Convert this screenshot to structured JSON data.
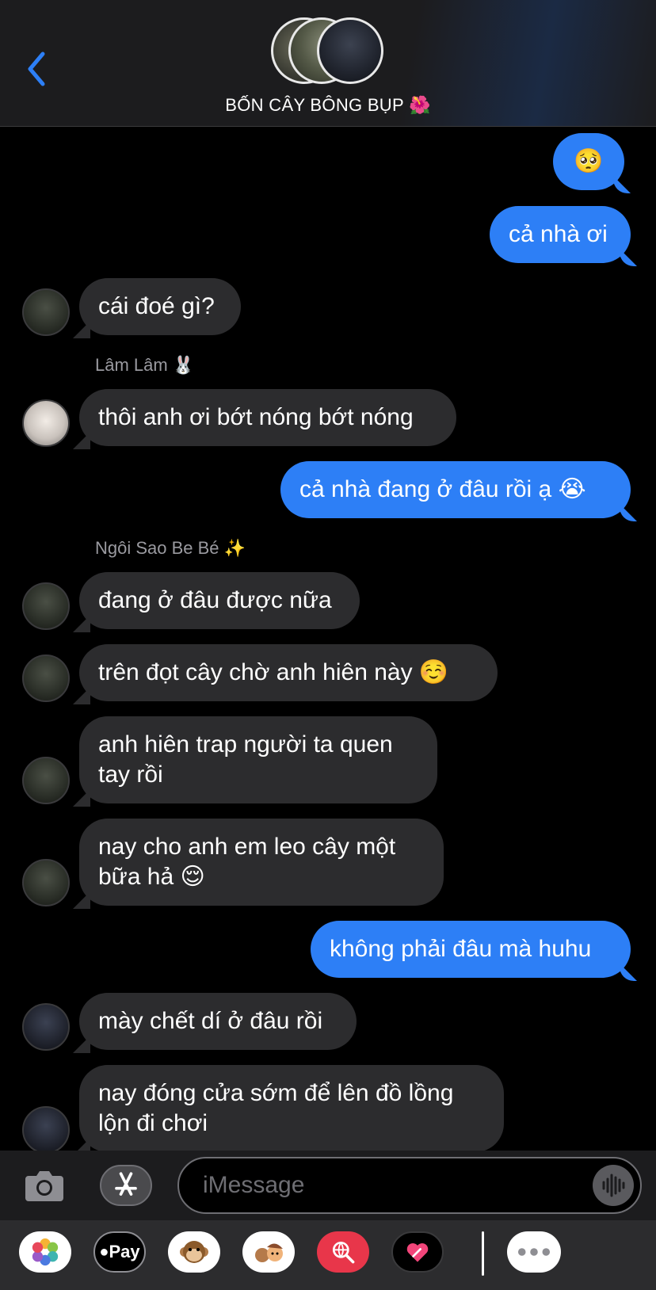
{
  "header": {
    "title": "BỐN CÂY BÔNG BỤP 🌺",
    "back_icon": "chevron-left-icon"
  },
  "messages": [
    {
      "direction": "out",
      "text": "🥺"
    },
    {
      "direction": "out",
      "text": "cả nhà ơi"
    },
    {
      "direction": "in",
      "text": "cái đoé gì?"
    },
    {
      "direction": "in",
      "sender": "Lâm Lâm 🐰",
      "text": "thôi anh ơi bớt nóng bớt nóng"
    },
    {
      "direction": "out",
      "text": "cả nhà đang ở đâu rồi ạ 😭"
    },
    {
      "direction": "in",
      "sender": "Ngôi Sao Be Bé ✨",
      "text": "đang ở đâu được nữa"
    },
    {
      "direction": "in",
      "text": "trên đọt cây chờ anh hiên này ☺️"
    },
    {
      "direction": "in",
      "text": "anh hiên trap người ta quen\ntay rồi"
    },
    {
      "direction": "in",
      "text": "nay cho anh em leo cây một\nbữa hả 😌"
    },
    {
      "direction": "out",
      "text": "không phải đâu mà huhu"
    },
    {
      "direction": "in",
      "text": "mày chết dí ở đâu rồi"
    },
    {
      "direction": "in",
      "text": "nay đóng cửa sớm để lên đồ lồng\nlộn đi chơi"
    }
  ],
  "input": {
    "placeholder": "iMessage",
    "camera_icon": "camera-icon",
    "appstore_icon": "app-store-icon",
    "audio_icon": "audio-waveform-icon"
  },
  "apps": [
    {
      "name": "photos-app-icon",
      "label": ""
    },
    {
      "name": "apple-pay-app-icon",
      "label": "Pay"
    },
    {
      "name": "animoji-app-icon",
      "label": ""
    },
    {
      "name": "memoji-app-icon",
      "label": ""
    },
    {
      "name": "image-search-app-icon",
      "label": ""
    },
    {
      "name": "digital-touch-app-icon",
      "label": ""
    },
    {
      "name": "more-apps-icon",
      "label": ""
    }
  ],
  "colors": {
    "outgoing_bubble": "#2d7ff6",
    "incoming_bubble": "#2c2c2e",
    "accent": "#2d7ff6"
  }
}
